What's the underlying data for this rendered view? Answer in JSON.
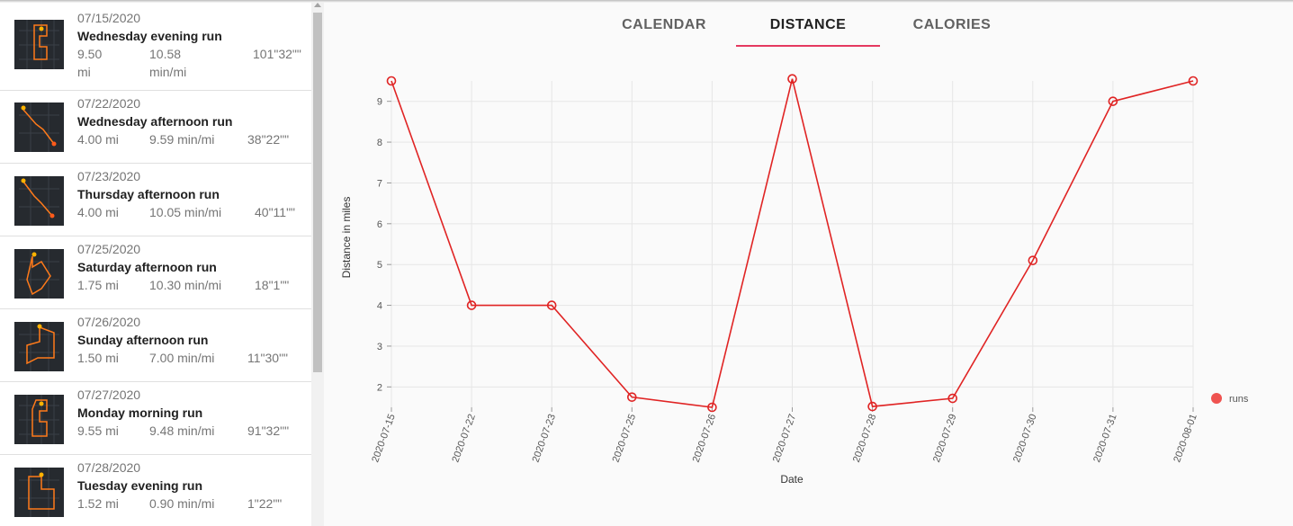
{
  "tabs": [
    {
      "label": "CALENDAR",
      "active": false
    },
    {
      "label": "DISTANCE",
      "active": true
    },
    {
      "label": "CALORIES",
      "active": false
    }
  ],
  "runs": [
    {
      "date": "07/15/2020",
      "title": "Wednesday evening run",
      "distance": "9.50",
      "distance_unit": "mi",
      "pace": "10.58",
      "pace_unit": "min/mi",
      "duration": "101\"32\"\""
    },
    {
      "date": "07/22/2020",
      "title": "Wednesday afternoon run",
      "distance": "4.00 mi",
      "pace": "9.59 min/mi",
      "duration": "38\"22\"\""
    },
    {
      "date": "07/23/2020",
      "title": "Thursday afternoon run",
      "distance": "4.00 mi",
      "pace": "10.05 min/mi",
      "duration": "40\"11\"\""
    },
    {
      "date": "07/25/2020",
      "title": "Saturday afternoon run",
      "distance": "1.75 mi",
      "pace": "10.30 min/mi",
      "duration": "18\"1\"\""
    },
    {
      "date": "07/26/2020",
      "title": "Sunday afternoon run",
      "distance": "1.50 mi",
      "pace": "7.00 min/mi",
      "duration": "11\"30\"\""
    },
    {
      "date": "07/27/2020",
      "title": "Monday morning run",
      "distance": "9.55 mi",
      "pace": "9.48 min/mi",
      "duration": "91\"32\"\""
    },
    {
      "date": "07/28/2020",
      "title": "Tuesday evening run",
      "distance": "1.52 mi",
      "pace": "0.90 min/mi",
      "duration": "1\"22\"\""
    }
  ],
  "chart_data": {
    "type": "line",
    "x": [
      "2020-07-15",
      "2020-07-22",
      "2020-07-23",
      "2020-07-25",
      "2020-07-26",
      "2020-07-27",
      "2020-07-28",
      "2020-07-29",
      "2020-07-30",
      "2020-07-31",
      "2020-08-01"
    ],
    "series": [
      {
        "name": "runs",
        "values": [
          9.5,
          4.0,
          4.0,
          1.75,
          1.5,
          9.55,
          1.52,
          1.72,
          5.1,
          9.0,
          9.5
        ],
        "color": "#e02424"
      }
    ],
    "xlabel": "Date",
    "ylabel": "Distance in miles",
    "yticks": [
      2,
      3,
      4,
      5,
      6,
      7,
      8,
      9
    ],
    "ylim": [
      1.5,
      9.5
    ],
    "grid": true,
    "legend_position": "right"
  }
}
